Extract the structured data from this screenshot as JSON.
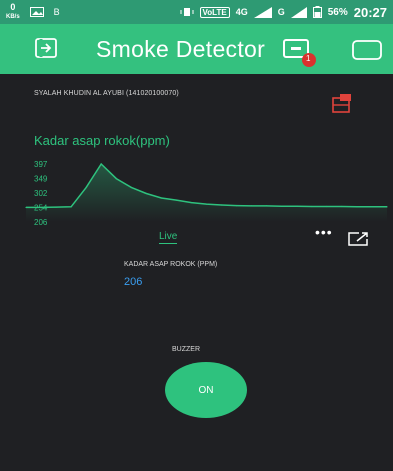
{
  "status_bar": {
    "speed_value": "0",
    "speed_unit": "KB/s",
    "volte": "VoLTE",
    "network": "4G",
    "network2": "G",
    "battery": "56%",
    "time": "20:27"
  },
  "app": {
    "title": "Smoke Detector",
    "notification_badge": "1"
  },
  "content": {
    "username": "SYALAH KHUDIN AL AYUBI (141020100070)",
    "chart_tab": "Live",
    "value_label": "KADAR ASAP ROKOK (PPM)",
    "value": "206",
    "buzzer_label": "BUZZER",
    "buzzer_button": "ON"
  },
  "colors": {
    "app_bar": "#34c17f",
    "status_bar": "#2e9a73",
    "accent_green": "#2ec27e",
    "value_blue": "#3a9ef0",
    "background": "#1f2023"
  },
  "chart_data": {
    "type": "area",
    "title": "Kadar asap rokok(ppm)",
    "ylabel": "",
    "xlabel": "",
    "y_ticks": [
      "397",
      "349",
      "302",
      "254",
      "206"
    ],
    "ylim": [
      206,
      397
    ],
    "values": [
      254,
      254,
      255,
      256,
      320,
      397,
      349,
      320,
      300,
      285,
      278,
      270,
      265,
      262,
      260,
      259,
      259,
      258,
      258,
      257,
      257,
      257,
      256,
      256,
      256
    ],
    "series": [
      {
        "name": "",
        "color": "#2ec27e"
      }
    ]
  }
}
